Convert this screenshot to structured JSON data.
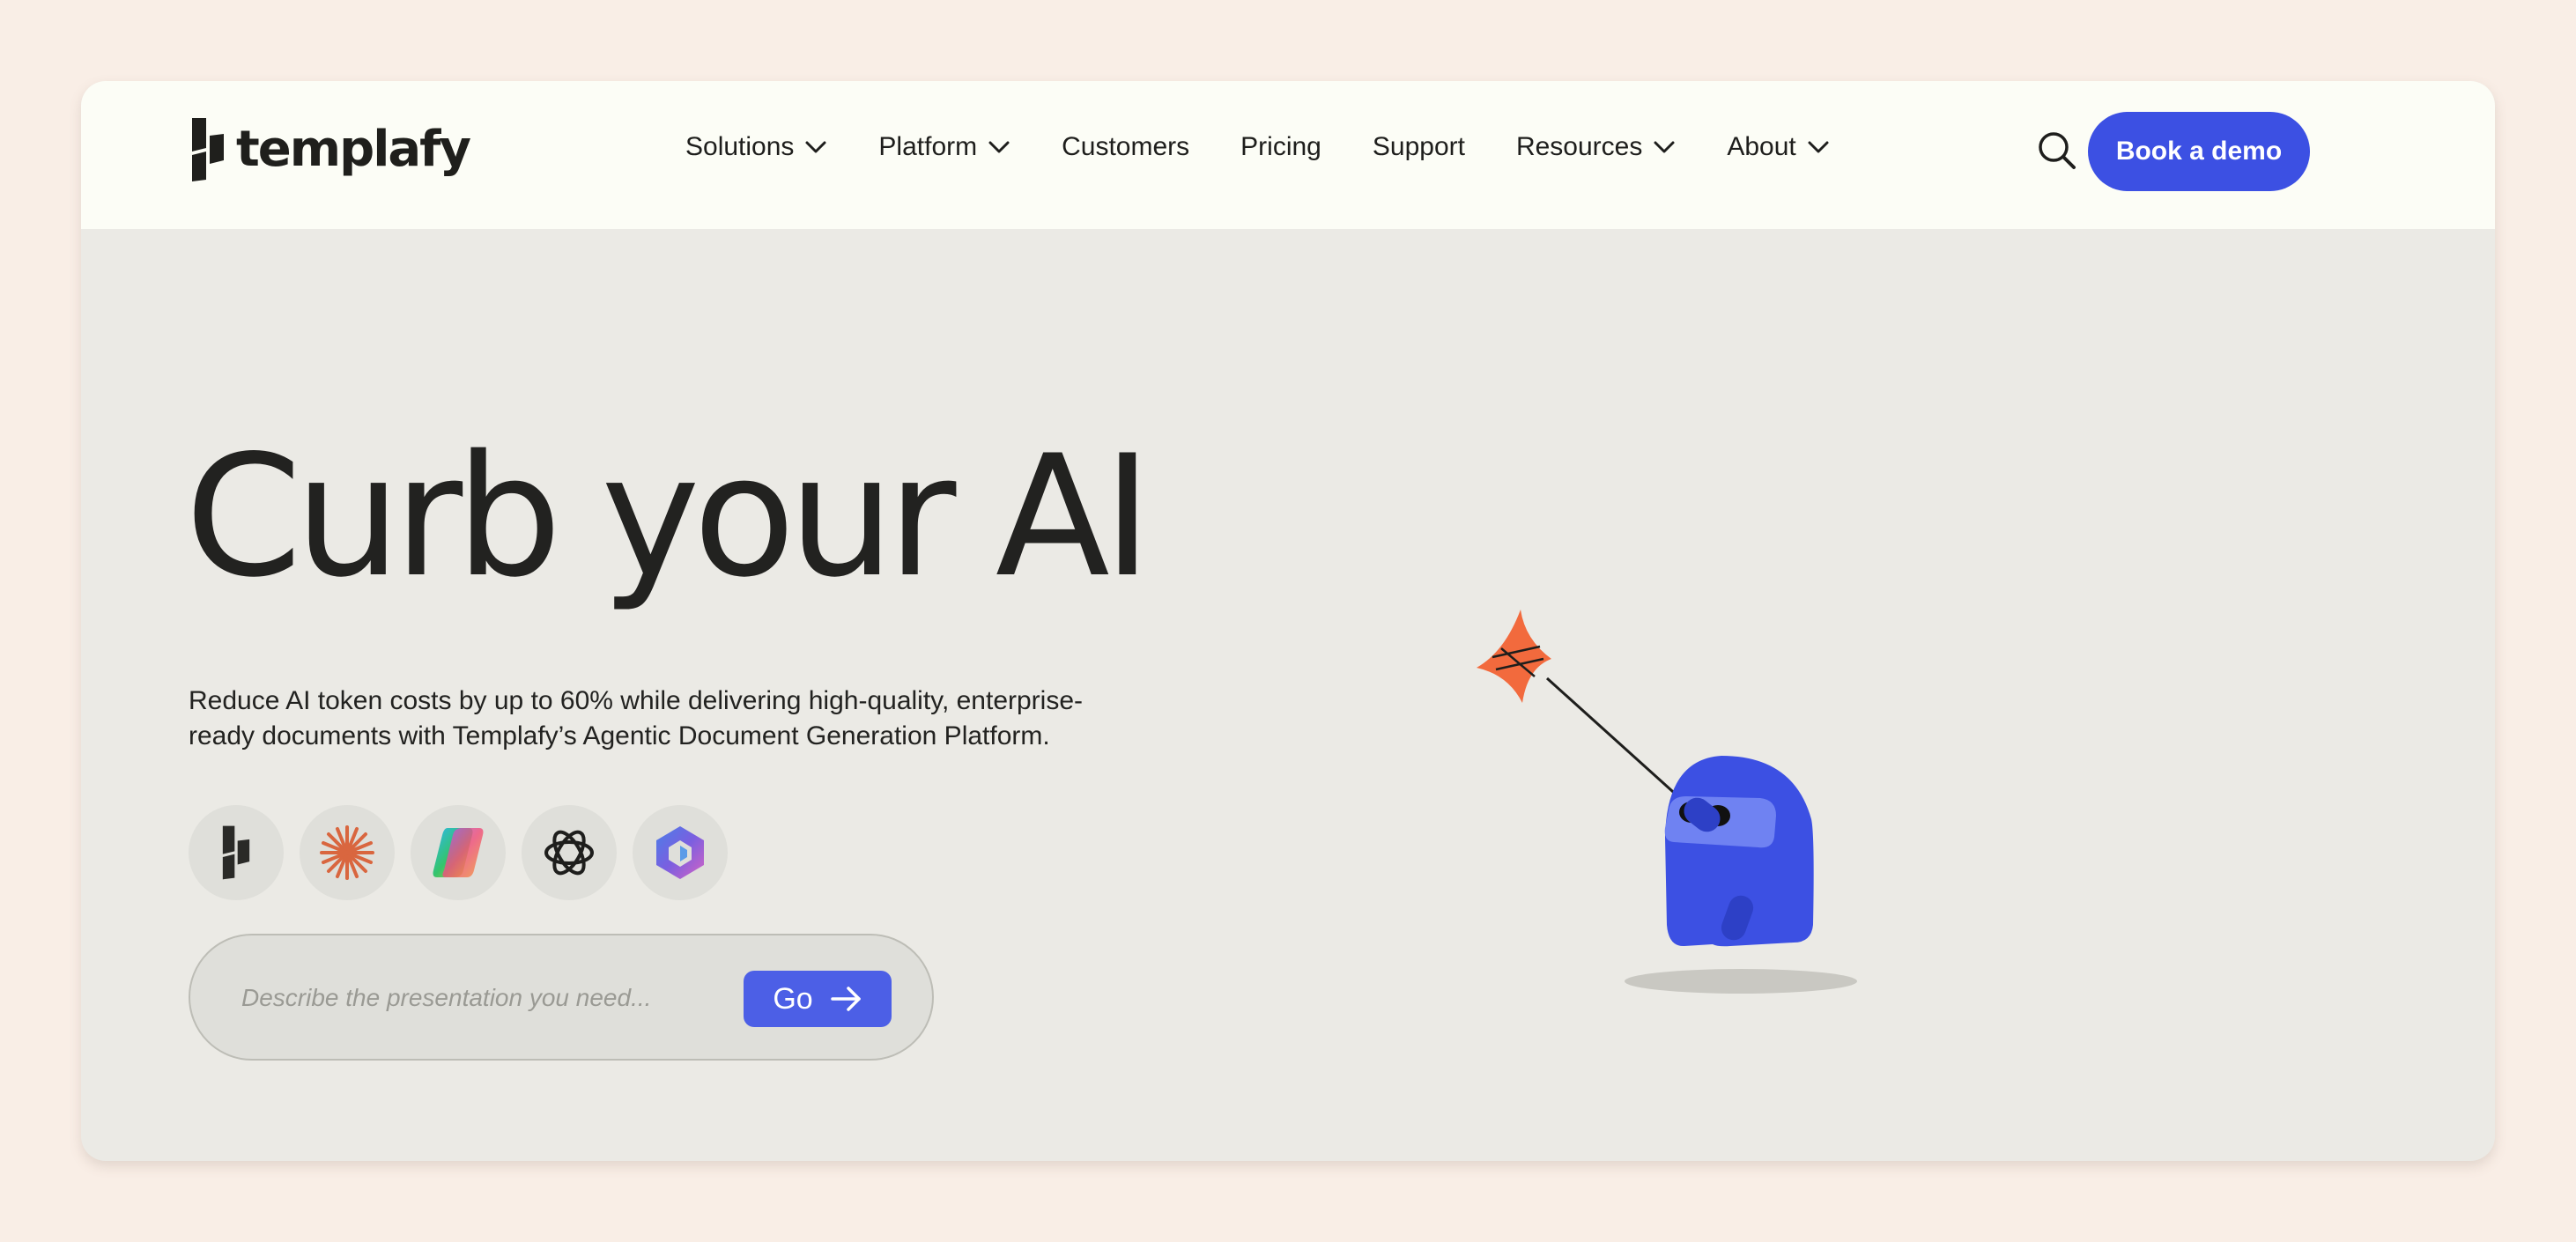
{
  "brand": {
    "name": "templafy"
  },
  "nav": {
    "items": [
      {
        "label": "Solutions",
        "dropdown": true
      },
      {
        "label": "Platform",
        "dropdown": true
      },
      {
        "label": "Customers",
        "dropdown": false
      },
      {
        "label": "Pricing",
        "dropdown": false
      },
      {
        "label": "Support",
        "dropdown": false
      },
      {
        "label": "Resources",
        "dropdown": true
      },
      {
        "label": "About",
        "dropdown": true
      }
    ],
    "search_icon": "search-icon",
    "cta_label": "Book a demo"
  },
  "hero": {
    "title": "Curb your AI",
    "subtitle": "Reduce AI token costs by up to 60% while delivering high-quality, enterprise-ready documents with Templafy’s Agentic Document Generation Platform.",
    "ai_icons": [
      "templafy-icon",
      "claude-icon",
      "copilot-icon",
      "openai-icon",
      "microsoft365-icon"
    ],
    "prompt": {
      "placeholder": "Describe the presentation you need...",
      "button_label": "Go"
    }
  },
  "colors": {
    "page_bg": "#f9eee6",
    "hero_bg": "#ebeae5",
    "nav_bg": "#fcfdf6",
    "accent": "#3c50e3",
    "kite": "#f26a3d",
    "mascot": "#3c50e3"
  }
}
